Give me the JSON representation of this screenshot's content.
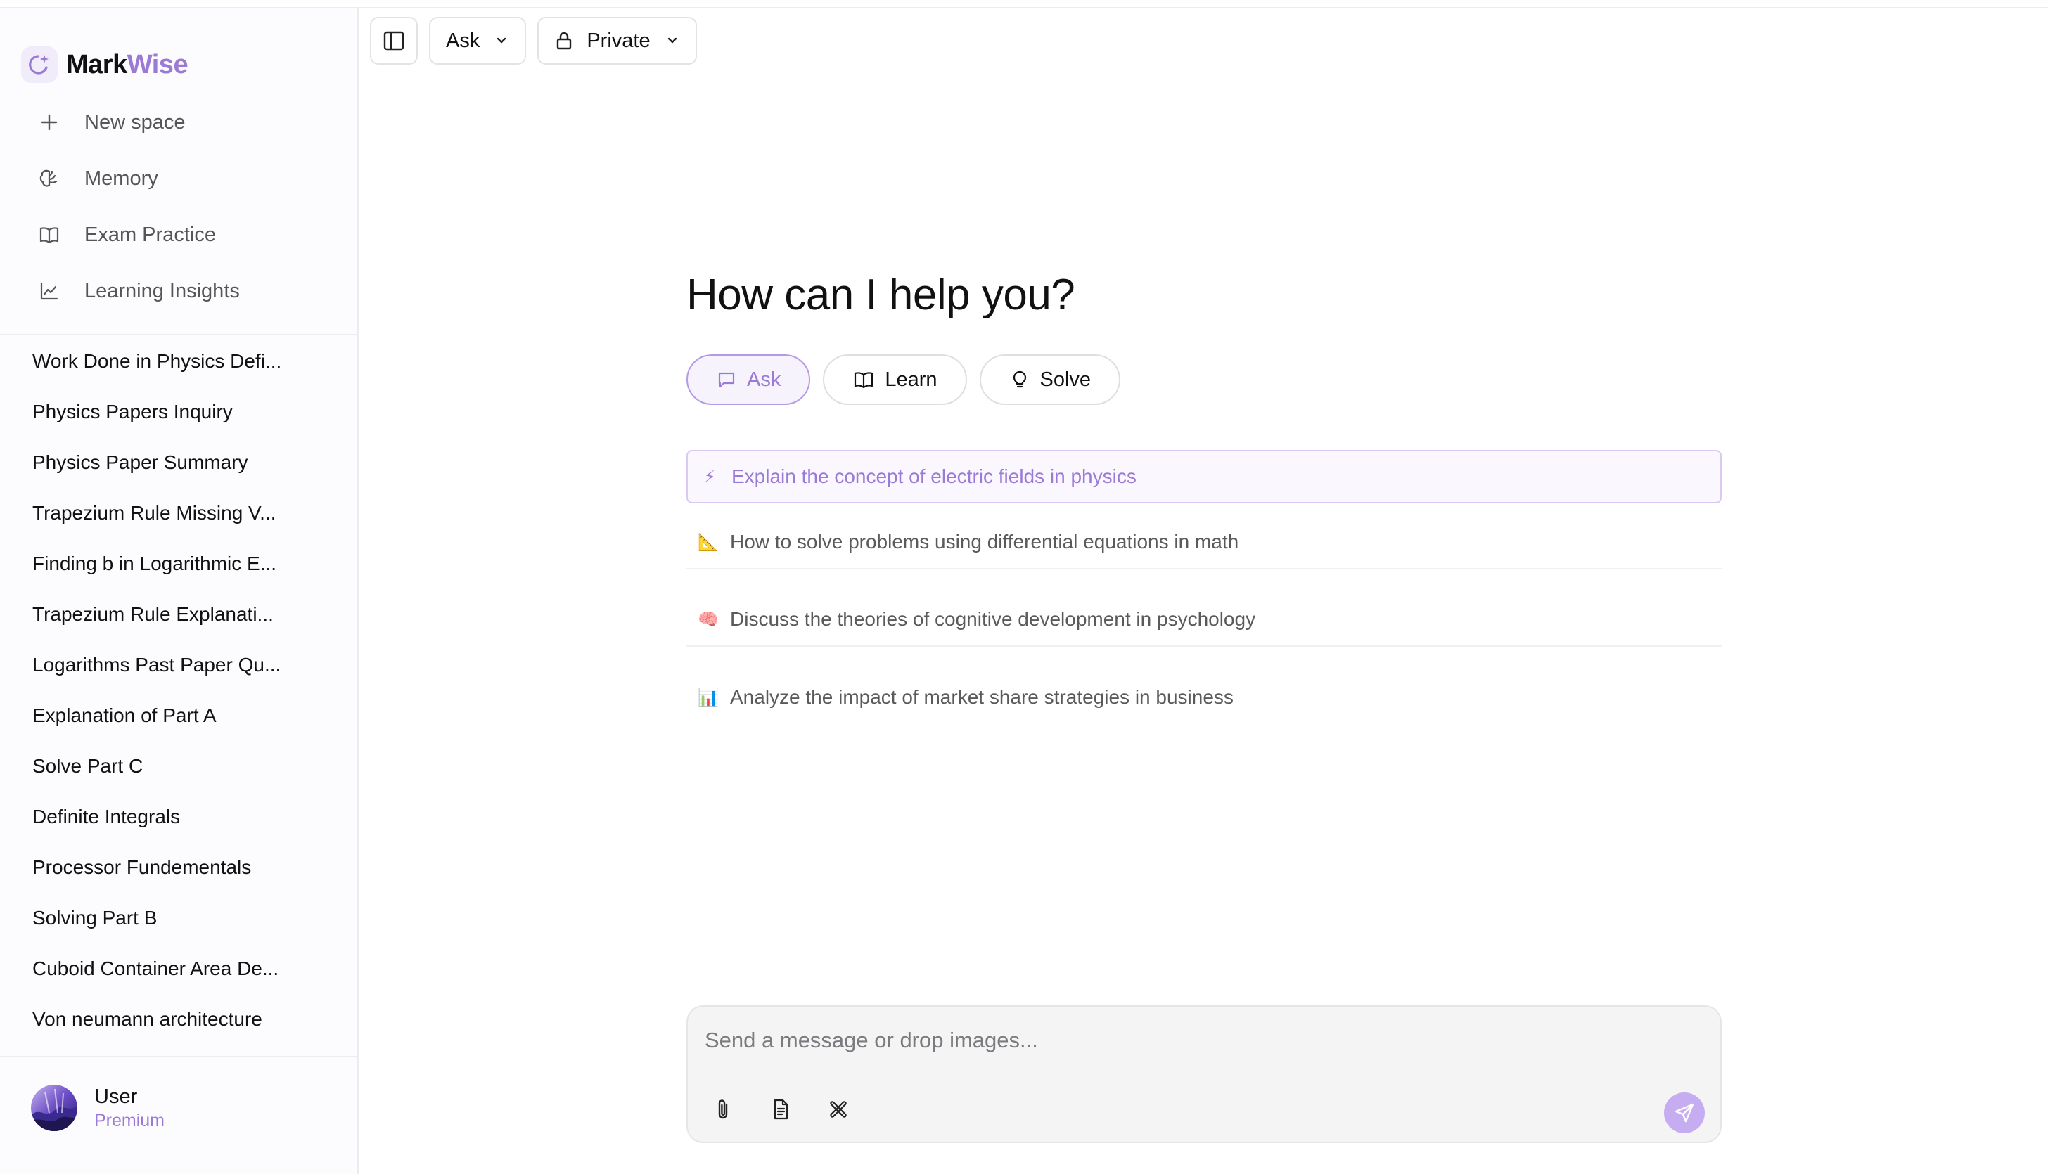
{
  "brand": {
    "name_part1": "Mark",
    "name_part2": "Wise",
    "accent_color": "#9b7ad6"
  },
  "nav": {
    "items": [
      {
        "label": "New space",
        "icon": "plus-icon"
      },
      {
        "label": "Memory",
        "icon": "brain-icon"
      },
      {
        "label": "Exam Practice",
        "icon": "book-icon"
      },
      {
        "label": "Learning Insights",
        "icon": "chart-line-icon"
      }
    ]
  },
  "history": [
    "Work Done in Physics Defi...",
    "Physics Papers Inquiry",
    "Physics Paper Summary",
    "Trapezium Rule Missing V...",
    "Finding b in Logarithmic E...",
    "Trapezium Rule Explanati...",
    "Logarithms Past Paper Qu...",
    "Explanation of Part A",
    "Solve Part C",
    "Definite Integrals",
    "Processor Fundementals",
    "Solving Part B",
    "Cuboid Container Area De...",
    "Von neumann architecture"
  ],
  "user": {
    "name": "User",
    "plan": "Premium"
  },
  "toolbar": {
    "mode_label": "Ask",
    "visibility_label": "Private"
  },
  "main": {
    "headline": "How can I help you?",
    "modes": [
      {
        "label": "Ask",
        "icon": "chat-bubble-icon",
        "active": true
      },
      {
        "label": "Learn",
        "icon": "book-open-icon",
        "active": false
      },
      {
        "label": "Solve",
        "icon": "lightbulb-icon",
        "active": false
      }
    ],
    "suggestions": [
      {
        "emoji": "⚡",
        "text": "Explain the concept of electric fields in physics"
      },
      {
        "emoji": "📐",
        "text": "How to solve problems using differential equations in math"
      },
      {
        "emoji": "🧠",
        "text": "Discuss the theories of cognitive development in psychology"
      },
      {
        "emoji": "📊",
        "text": "Analyze the impact of market share strategies in business"
      }
    ]
  },
  "composer": {
    "placeholder": "Send a message or drop images..."
  }
}
